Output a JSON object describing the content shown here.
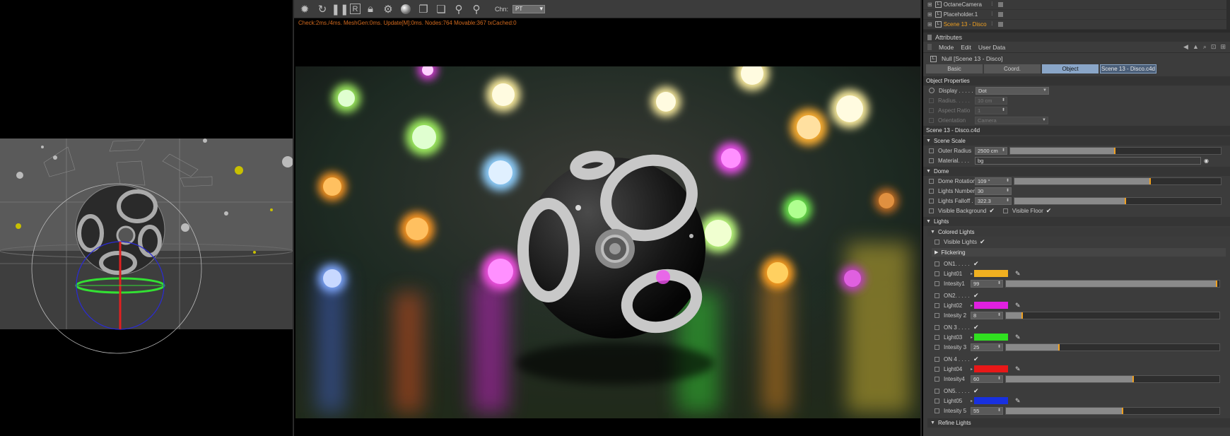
{
  "objects": [
    {
      "name": "OctaneCamera",
      "active": false
    },
    {
      "name": "Placeholder.1",
      "active": false
    },
    {
      "name": "Scene 13 - Disco",
      "active": true
    }
  ],
  "render": {
    "toolbar": {
      "channel_label": "Chn:",
      "channel_value": "PT"
    },
    "status": "Check:2ms./4ms. MeshGen:0ms. Update[M]:0ms. Nodes:764 Movable:367 txCached:0"
  },
  "attributes": {
    "title": "Attributes",
    "menu": [
      "Mode",
      "Edit",
      "User Data"
    ],
    "object_title": "Null [Scene 13 - Disco]",
    "tabs": [
      "Basic",
      "Coord.",
      "Object",
      "Scene 13 - Disco.c4d"
    ],
    "active_tab": "Object",
    "object_properties_label": "Object Properties",
    "display": {
      "label": "Display . . . . .",
      "value": "Dot"
    },
    "radius": {
      "label": "Radius. . . . .",
      "value": "10 cm"
    },
    "aspect_ratio": {
      "label": "Aspect Ratio",
      "value": "1"
    },
    "orientation": {
      "label": "Orientation",
      "value": "Camera"
    },
    "file_section": "Scene 13 - Disco.c4d",
    "scene_scale": {
      "group": "Scene Scale",
      "outer_radius": {
        "label": "Outer Radius",
        "value": "2500 cm",
        "fraction": 0.5
      },
      "material": {
        "label": "Material. . . .",
        "value": "bg"
      }
    },
    "dome": {
      "group": "Dome",
      "rotation": {
        "label": "Dome Rotation",
        "value": "109 °",
        "fraction": 0.66
      },
      "lights_number": {
        "label": "Lights Number",
        "value": "30"
      },
      "lights_falloff": {
        "label": "Lights Falloff .",
        "value": "322.3",
        "fraction": 0.54
      },
      "visible_background": {
        "label": "Visible Background",
        "check": "✔"
      },
      "visible_floor": {
        "label": "Visible Floor",
        "check": "✔"
      }
    },
    "lights": {
      "group": "Lights",
      "colored_lights": "Colored Lights",
      "visible_lights": {
        "label": "Visible Lights",
        "check": "✔"
      },
      "flickering": "Flickering",
      "items": [
        {
          "on_label": "ON1. . . . .",
          "light_label": "Light01",
          "int_label": "Intesity1",
          "value": "99",
          "fraction": 0.99,
          "color": "#f0b020"
        },
        {
          "on_label": "ON2. . . . .",
          "light_label": "Light02",
          "int_label": "Intesity 2",
          "value": "8",
          "fraction": 0.08,
          "color": "#e020e0"
        },
        {
          "on_label": "ON 3 . . . .",
          "light_label": "Light03",
          "int_label": "Intesity 3",
          "value": "25",
          "fraction": 0.25,
          "color": "#30e020"
        },
        {
          "on_label": "ON 4 . . . .",
          "light_label": "Light04",
          "int_label": "Intesity4",
          "value": "60",
          "fraction": 0.6,
          "color": "#e81818"
        },
        {
          "on_label": "ON5. . . . .",
          "light_label": "Light05",
          "int_label": "Intesity 5",
          "value": "55",
          "fraction": 0.55,
          "color": "#1830e0"
        }
      ],
      "check": "✔"
    },
    "refine_lights": "Refine Lights"
  },
  "colors": {
    "accent": "#f0a020",
    "tab_active": "#8aa6c8",
    "panel_bg": "#3c3c3c"
  }
}
